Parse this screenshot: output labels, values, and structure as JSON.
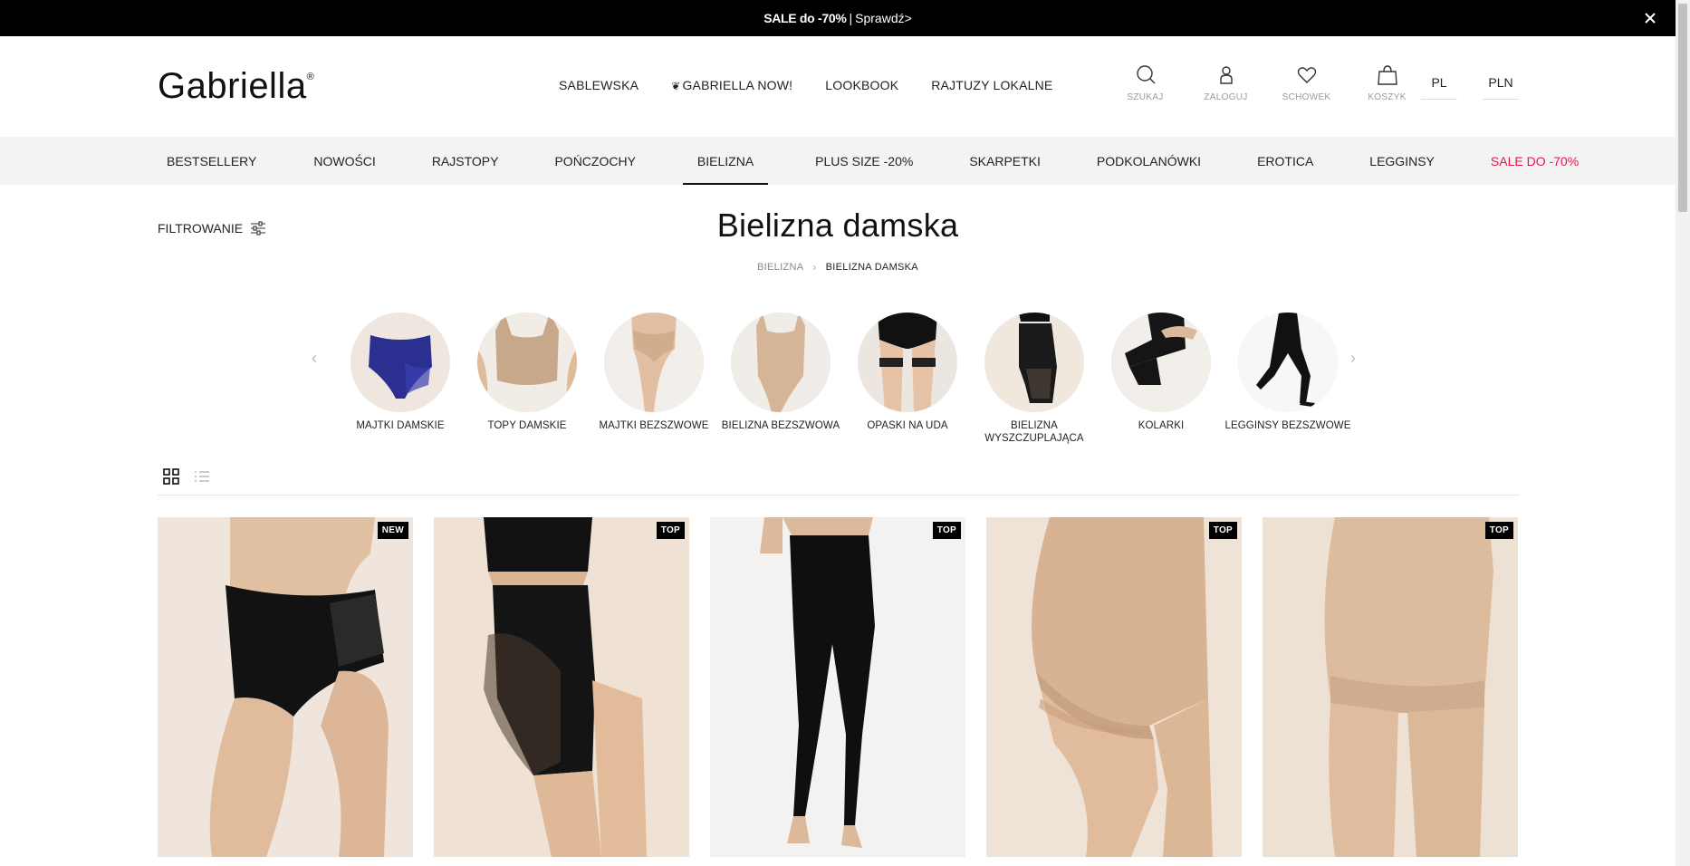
{
  "promo": {
    "sale_text": "SALE do -70%",
    "separator": "|",
    "link_text": "Sprawdź>"
  },
  "header": {
    "logo": "Gabriella",
    "logo_mark": "®",
    "nav": [
      {
        "label": "SABLEWSKA"
      },
      {
        "label": "GABRIELLA NOW!"
      },
      {
        "label": "LOOKBOOK"
      },
      {
        "label": "RAJTUZY LOKALNE"
      }
    ],
    "icons": [
      {
        "name": "search-icon",
        "label": "SZUKAJ"
      },
      {
        "name": "user-icon",
        "label": "ZALOGUJ"
      },
      {
        "name": "heart-icon",
        "label": "SCHOWEK"
      },
      {
        "name": "bag-icon",
        "label": "KOSZYK"
      }
    ],
    "language": "PL",
    "currency": "PLN"
  },
  "categories": [
    {
      "label": "BESTSELLERY"
    },
    {
      "label": "NOWOŚCI"
    },
    {
      "label": "RAJSTOPY"
    },
    {
      "label": "POŃCZOCHY"
    },
    {
      "label": "BIELIZNA",
      "active": true
    },
    {
      "label": "PLUS SIZE -20%"
    },
    {
      "label": "SKARPETKI"
    },
    {
      "label": "PODKOLANÓWKI"
    },
    {
      "label": "EROTICA"
    },
    {
      "label": "LEGGINSY"
    },
    {
      "label": "SALE DO -70%",
      "sale": true
    }
  ],
  "colors": {
    "sale": "#e6164b",
    "bar": "#000000",
    "catbar": "#f3f3f3"
  },
  "filter_label": "FILTROWANIE",
  "page_title": "Bielizna damska",
  "breadcrumb": {
    "parent": "BIELIZNA",
    "current": "BIELIZNA DAMSKA"
  },
  "subcategories": [
    {
      "label": "MAJTKI DAMSKIE"
    },
    {
      "label": "TOPY DAMSKIE"
    },
    {
      "label": "MAJTKI BEZSZWOWE"
    },
    {
      "label": "BIELIZNA BEZSZWOWA"
    },
    {
      "label": "OPASKI NA UDA"
    },
    {
      "label": "BIELIZNA WYSZCZUPLAJĄCA"
    },
    {
      "label": "KOLARKI"
    },
    {
      "label": "LEGGINSY BEZSZWOWE"
    }
  ],
  "products": [
    {
      "badge": "NEW"
    },
    {
      "badge": "TOP"
    },
    {
      "badge": "TOP"
    },
    {
      "badge": "TOP"
    },
    {
      "badge": "TOP"
    }
  ]
}
